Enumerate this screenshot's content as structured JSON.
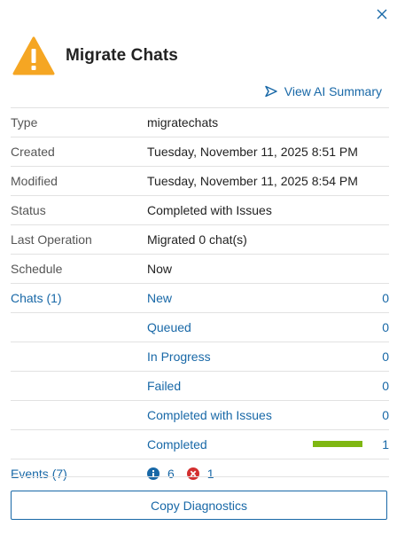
{
  "dialog": {
    "title": "Migrate Chats",
    "ai_summary_label": "View AI Summary",
    "copy_button_label": "Copy Diagnostics"
  },
  "details": [
    {
      "label": "Type",
      "value": "migratechats"
    },
    {
      "label": "Created",
      "value": "Tuesday, November 11, 2025 8:51 PM"
    },
    {
      "label": "Modified",
      "value": "Tuesday, November 11, 2025 8:54 PM"
    },
    {
      "label": "Status",
      "value": "Completed with Issues"
    },
    {
      "label": "Last Operation",
      "value": "Migrated 0 chat(s)"
    },
    {
      "label": "Schedule",
      "value": "Now"
    }
  ],
  "chats": {
    "label": "Chats (1)",
    "items": [
      {
        "label": "New",
        "count": "0"
      },
      {
        "label": "Queued",
        "count": "0"
      },
      {
        "label": "In Progress",
        "count": "0"
      },
      {
        "label": "Failed",
        "count": "0"
      },
      {
        "label": "Completed with Issues",
        "count": "0"
      },
      {
        "label": "Completed",
        "count": "1",
        "progress_fraction": 1.0
      }
    ]
  },
  "events": {
    "label": "Events (7)",
    "info_count": "6",
    "error_count": "1"
  },
  "colors": {
    "link": "#1868a7",
    "warning": "#f5a623",
    "progress": "#7fb712",
    "error": "#d32f2f"
  }
}
